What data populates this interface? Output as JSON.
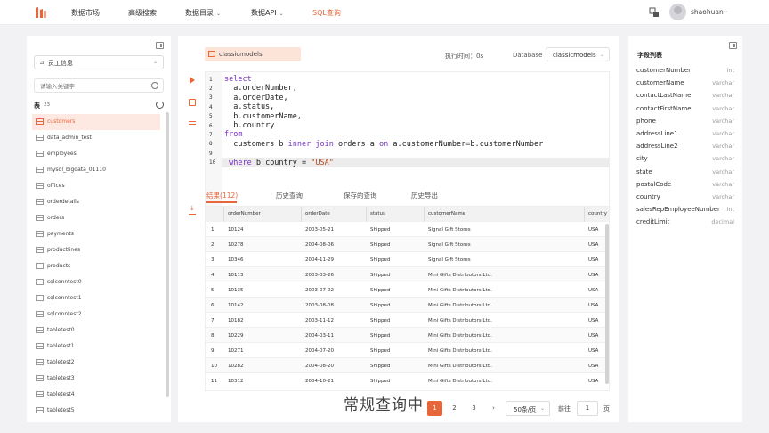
{
  "nav": {
    "items": [
      {
        "label": "数据市场",
        "caret": false,
        "active": false
      },
      {
        "label": "高级搜索",
        "caret": false,
        "active": false
      },
      {
        "label": "数据目录",
        "caret": true,
        "active": false
      },
      {
        "label": "数据API",
        "caret": true,
        "active": false
      },
      {
        "label": "SQL查询",
        "caret": false,
        "active": true
      }
    ],
    "username": "shaohuan",
    "caret": "⌄"
  },
  "sidebar": {
    "database": "员工信息",
    "search_placeholder": "请输入关键字",
    "table_heading": "表",
    "table_count": "23",
    "tables": [
      "customers",
      "data_admin_test",
      "employees",
      "mysql_bigdata_01110",
      "offices",
      "orderdetails",
      "orders",
      "payments",
      "productlines",
      "products",
      "sqlconntest0",
      "sqlconntest1",
      "sqlconntest2",
      "tabletest0",
      "tabletest1",
      "tabletest2",
      "tabletest3",
      "tabletest4",
      "tabletest5"
    ],
    "selected_index": 0
  },
  "editor": {
    "db_tag": "classicmodels",
    "exec_time": "执行时间：0s",
    "db_label": "Database",
    "db_value": "classicmodels",
    "lines": [
      {
        "n": "1",
        "code": [
          {
            "t": "select",
            "c": "kw"
          }
        ]
      },
      {
        "n": "2",
        "code": [
          {
            "t": "  a.orderNumber,",
            "c": ""
          }
        ]
      },
      {
        "n": "3",
        "code": [
          {
            "t": "  a.orderDate,",
            "c": ""
          }
        ]
      },
      {
        "n": "4",
        "code": [
          {
            "t": "  a.status,",
            "c": ""
          }
        ]
      },
      {
        "n": "5",
        "code": [
          {
            "t": "  b.customerName,",
            "c": ""
          }
        ]
      },
      {
        "n": "6",
        "code": [
          {
            "t": "  b.country",
            "c": ""
          }
        ]
      },
      {
        "n": "7",
        "code": [
          {
            "t": "from",
            "c": "kw"
          }
        ]
      },
      {
        "n": "8",
        "code": [
          {
            "t": "  customers b ",
            "c": ""
          },
          {
            "t": "inner join",
            "c": "kw"
          },
          {
            "t": " orders a ",
            "c": ""
          },
          {
            "t": "on",
            "c": "kw"
          },
          {
            "t": " a.customerNumber=b.customerNumber",
            "c": ""
          }
        ]
      },
      {
        "n": "9",
        "code": []
      },
      {
        "n": "10",
        "code": [
          {
            "t": " where",
            "c": "kw"
          },
          {
            "t": " b.country = ",
            "c": ""
          },
          {
            "t": "\"USA\"",
            "c": "str"
          }
        ]
      }
    ]
  },
  "results": {
    "tabs": [
      "结果(112)",
      "历史查询",
      "保存的查询",
      "历史导出"
    ],
    "columns": [
      "orderNumber",
      "orderDate",
      "status",
      "customerName",
      "country"
    ],
    "rows": [
      [
        "1",
        "10124",
        "2003-05-21",
        "Shipped",
        "Signal Gift Stores",
        "USA"
      ],
      [
        "2",
        "10278",
        "2004-08-06",
        "Shipped",
        "Signal Gift Stores",
        "USA"
      ],
      [
        "3",
        "10346",
        "2004-11-29",
        "Shipped",
        "Signal Gift Stores",
        "USA"
      ],
      [
        "4",
        "10113",
        "2003-03-26",
        "Shipped",
        "Mini Gifts Distributors Ltd.",
        "USA"
      ],
      [
        "5",
        "10135",
        "2003-07-02",
        "Shipped",
        "Mini Gifts Distributors Ltd.",
        "USA"
      ],
      [
        "6",
        "10142",
        "2003-08-08",
        "Shipped",
        "Mini Gifts Distributors Ltd.",
        "USA"
      ],
      [
        "7",
        "10182",
        "2003-11-12",
        "Shipped",
        "Mini Gifts Distributors Ltd.",
        "USA"
      ],
      [
        "8",
        "10229",
        "2004-03-11",
        "Shipped",
        "Mini Gifts Distributors Ltd.",
        "USA"
      ],
      [
        "9",
        "10271",
        "2004-07-20",
        "Shipped",
        "Mini Gifts Distributors Ltd.",
        "USA"
      ],
      [
        "10",
        "10282",
        "2004-08-20",
        "Shipped",
        "Mini Gifts Distributors Ltd.",
        "USA"
      ],
      [
        "11",
        "10312",
        "2004-10-21",
        "Shipped",
        "Mini Gifts Distributors Ltd.",
        "USA"
      ]
    ]
  },
  "pagination": {
    "watermark": "常规查询中",
    "prev": "‹",
    "pages": [
      "1",
      "2",
      "3"
    ],
    "next": "›",
    "page_size": "50条/页",
    "goto_label": "前往",
    "goto_value": "1",
    "goto_unit": "页"
  },
  "fields": {
    "title": "字段列表",
    "items": [
      {
        "name": "customerNumber",
        "type": "int"
      },
      {
        "name": "customerName",
        "type": "varchar"
      },
      {
        "name": "contactLastName",
        "type": "varchar"
      },
      {
        "name": "contactFirstName",
        "type": "varchar"
      },
      {
        "name": "phone",
        "type": "varchar"
      },
      {
        "name": "addressLine1",
        "type": "varchar"
      },
      {
        "name": "addressLine2",
        "type": "varchar"
      },
      {
        "name": "city",
        "type": "varchar"
      },
      {
        "name": "state",
        "type": "varchar"
      },
      {
        "name": "postalCode",
        "type": "varchar"
      },
      {
        "name": "country",
        "type": "varchar"
      },
      {
        "name": "salesRepEmployeeNumber",
        "type": "int"
      },
      {
        "name": "creditLimit",
        "type": "decimal"
      }
    ]
  },
  "colors": {
    "accent": "#e8663b",
    "keyword": "#7a33c4",
    "string": "#b34a1e"
  }
}
